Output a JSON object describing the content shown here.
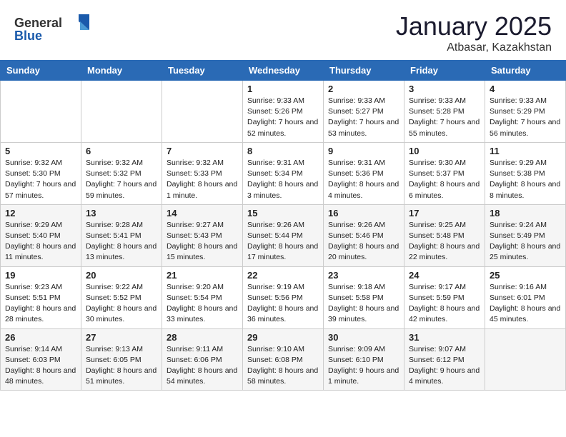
{
  "header": {
    "logo_general": "General",
    "logo_blue": "Blue",
    "month_year": "January 2025",
    "location": "Atbasar, Kazakhstan"
  },
  "days_of_week": [
    "Sunday",
    "Monday",
    "Tuesday",
    "Wednesday",
    "Thursday",
    "Friday",
    "Saturday"
  ],
  "weeks": [
    [
      {
        "day": "",
        "info": ""
      },
      {
        "day": "",
        "info": ""
      },
      {
        "day": "",
        "info": ""
      },
      {
        "day": "1",
        "info": "Sunrise: 9:33 AM\nSunset: 5:26 PM\nDaylight: 7 hours and 52 minutes."
      },
      {
        "day": "2",
        "info": "Sunrise: 9:33 AM\nSunset: 5:27 PM\nDaylight: 7 hours and 53 minutes."
      },
      {
        "day": "3",
        "info": "Sunrise: 9:33 AM\nSunset: 5:28 PM\nDaylight: 7 hours and 55 minutes."
      },
      {
        "day": "4",
        "info": "Sunrise: 9:33 AM\nSunset: 5:29 PM\nDaylight: 7 hours and 56 minutes."
      }
    ],
    [
      {
        "day": "5",
        "info": "Sunrise: 9:32 AM\nSunset: 5:30 PM\nDaylight: 7 hours and 57 minutes."
      },
      {
        "day": "6",
        "info": "Sunrise: 9:32 AM\nSunset: 5:32 PM\nDaylight: 7 hours and 59 minutes."
      },
      {
        "day": "7",
        "info": "Sunrise: 9:32 AM\nSunset: 5:33 PM\nDaylight: 8 hours and 1 minute."
      },
      {
        "day": "8",
        "info": "Sunrise: 9:31 AM\nSunset: 5:34 PM\nDaylight: 8 hours and 3 minutes."
      },
      {
        "day": "9",
        "info": "Sunrise: 9:31 AM\nSunset: 5:36 PM\nDaylight: 8 hours and 4 minutes."
      },
      {
        "day": "10",
        "info": "Sunrise: 9:30 AM\nSunset: 5:37 PM\nDaylight: 8 hours and 6 minutes."
      },
      {
        "day": "11",
        "info": "Sunrise: 9:29 AM\nSunset: 5:38 PM\nDaylight: 8 hours and 8 minutes."
      }
    ],
    [
      {
        "day": "12",
        "info": "Sunrise: 9:29 AM\nSunset: 5:40 PM\nDaylight: 8 hours and 11 minutes."
      },
      {
        "day": "13",
        "info": "Sunrise: 9:28 AM\nSunset: 5:41 PM\nDaylight: 8 hours and 13 minutes."
      },
      {
        "day": "14",
        "info": "Sunrise: 9:27 AM\nSunset: 5:43 PM\nDaylight: 8 hours and 15 minutes."
      },
      {
        "day": "15",
        "info": "Sunrise: 9:26 AM\nSunset: 5:44 PM\nDaylight: 8 hours and 17 minutes."
      },
      {
        "day": "16",
        "info": "Sunrise: 9:26 AM\nSunset: 5:46 PM\nDaylight: 8 hours and 20 minutes."
      },
      {
        "day": "17",
        "info": "Sunrise: 9:25 AM\nSunset: 5:48 PM\nDaylight: 8 hours and 22 minutes."
      },
      {
        "day": "18",
        "info": "Sunrise: 9:24 AM\nSunset: 5:49 PM\nDaylight: 8 hours and 25 minutes."
      }
    ],
    [
      {
        "day": "19",
        "info": "Sunrise: 9:23 AM\nSunset: 5:51 PM\nDaylight: 8 hours and 28 minutes."
      },
      {
        "day": "20",
        "info": "Sunrise: 9:22 AM\nSunset: 5:52 PM\nDaylight: 8 hours and 30 minutes."
      },
      {
        "day": "21",
        "info": "Sunrise: 9:20 AM\nSunset: 5:54 PM\nDaylight: 8 hours and 33 minutes."
      },
      {
        "day": "22",
        "info": "Sunrise: 9:19 AM\nSunset: 5:56 PM\nDaylight: 8 hours and 36 minutes."
      },
      {
        "day": "23",
        "info": "Sunrise: 9:18 AM\nSunset: 5:58 PM\nDaylight: 8 hours and 39 minutes."
      },
      {
        "day": "24",
        "info": "Sunrise: 9:17 AM\nSunset: 5:59 PM\nDaylight: 8 hours and 42 minutes."
      },
      {
        "day": "25",
        "info": "Sunrise: 9:16 AM\nSunset: 6:01 PM\nDaylight: 8 hours and 45 minutes."
      }
    ],
    [
      {
        "day": "26",
        "info": "Sunrise: 9:14 AM\nSunset: 6:03 PM\nDaylight: 8 hours and 48 minutes."
      },
      {
        "day": "27",
        "info": "Sunrise: 9:13 AM\nSunset: 6:05 PM\nDaylight: 8 hours and 51 minutes."
      },
      {
        "day": "28",
        "info": "Sunrise: 9:11 AM\nSunset: 6:06 PM\nDaylight: 8 hours and 54 minutes."
      },
      {
        "day": "29",
        "info": "Sunrise: 9:10 AM\nSunset: 6:08 PM\nDaylight: 8 hours and 58 minutes."
      },
      {
        "day": "30",
        "info": "Sunrise: 9:09 AM\nSunset: 6:10 PM\nDaylight: 9 hours and 1 minute."
      },
      {
        "day": "31",
        "info": "Sunrise: 9:07 AM\nSunset: 6:12 PM\nDaylight: 9 hours and 4 minutes."
      },
      {
        "day": "",
        "info": ""
      }
    ]
  ]
}
